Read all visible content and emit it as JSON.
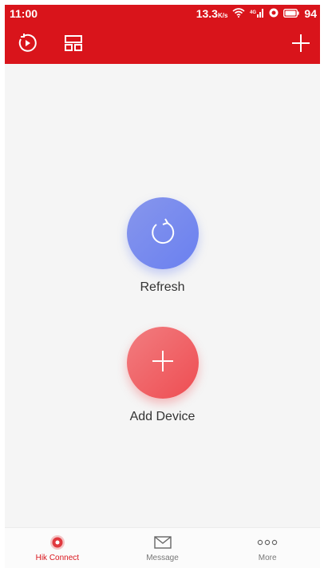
{
  "status_bar": {
    "time": "11:00",
    "speed": "13.3",
    "speed_unit": "K/s",
    "battery": "94"
  },
  "toolbar": {
    "playback_icon": "playback-icon",
    "layout_icon": "layout-icon",
    "add_icon": "plus-icon"
  },
  "main": {
    "refresh": {
      "label": "Refresh",
      "icon": "refresh-icon"
    },
    "add_device": {
      "label": "Add Device",
      "icon": "plus-icon"
    }
  },
  "bottom_nav": {
    "items": [
      {
        "label": "Hik Connect",
        "icon": "hik-connect-icon",
        "active": true
      },
      {
        "label": "Message",
        "icon": "envelope-icon",
        "active": false
      },
      {
        "label": "More",
        "icon": "more-dots-icon",
        "active": false
      }
    ]
  },
  "colors": {
    "brand_red": "#d9141b",
    "refresh_blue": "#7688ee",
    "add_red": "#ef5a5f",
    "background": "#f5f5f5"
  }
}
